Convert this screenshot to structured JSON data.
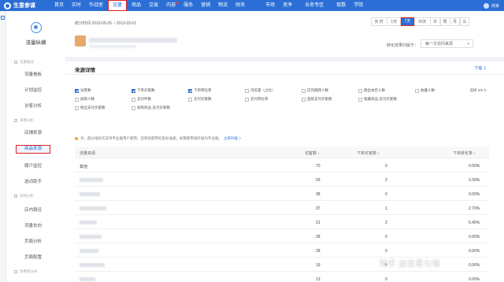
{
  "topnav": {
    "brand": "生意参谋",
    "items": [
      "首页",
      "实时",
      "作战室",
      "流量",
      "商品",
      "交易",
      "内容",
      "服务",
      "营销",
      "物流",
      "财务",
      "市场",
      "竞争",
      "业务专区",
      "取数",
      "学院"
    ],
    "active_item": "流量",
    "user": "商家"
  },
  "sidebar": {
    "title": "流量纵横",
    "groups": [
      {
        "label": "流量概况",
        "items": [
          "流量看板",
          "计划监控",
          "访客分析"
        ]
      },
      {
        "label": "来源分析",
        "items": [
          "店铺来源",
          "商品来源",
          "媒介监控",
          "选词助手"
        ]
      },
      {
        "label": "动线分析",
        "items": [
          "店内路径",
          "流量去向",
          "页面分析",
          "页面配置"
        ]
      },
      {
        "label": "消费者分析",
        "items": []
      }
    ],
    "active_item": "商品来源"
  },
  "statbar": {
    "time_label": "统计时间 2019-08-26 ~ 2019-09-01",
    "time_buttons": [
      "实 时",
      "1天",
      "7天",
      "30天",
      "日",
      "周",
      "月"
    ],
    "active_time": "7天",
    "conversion_label": "转化效果归属于：",
    "conversion_value": "每一次访问来源"
  },
  "panel": {
    "title": "来源详情",
    "download": "下载",
    "metrics": [
      {
        "label": "访客数",
        "checked": true
      },
      {
        "label": "下单买家数",
        "checked": true
      },
      {
        "label": "下单转化率",
        "checked": true
      },
      {
        "label": "浏览量（占比）",
        "checked": false
      },
      {
        "label": "店内跳转人数",
        "checked": false
      },
      {
        "label": "跳出本店人数",
        "checked": false
      },
      {
        "label": "收藏人数",
        "checked": false
      },
      {
        "label": "加购人数",
        "checked": false
      },
      {
        "label": "支付件数",
        "checked": false
      },
      {
        "label": "支付买家数",
        "checked": false
      },
      {
        "label": "支付转化率",
        "checked": false
      },
      {
        "label": "直接支付买家数",
        "checked": false
      },
      {
        "label": "收藏商品-支付买家数",
        "checked": false
      },
      {
        "label": "粉丝支付买家数",
        "checked": false
      },
      {
        "label": "加购商品-支付买家数",
        "checked": false
      }
    ],
    "selected_count": "选择 3/5",
    "notice_text": "亲，部分指标仅支持专业版用户使用，您目前使用的是标准版，如需使用请升级为专业版。",
    "notice_link": "立即升级 >"
  },
  "table": {
    "headers": [
      "流量来源",
      "访客数",
      "下单买家数",
      "下单转化率"
    ],
    "rows": [
      {
        "source": "其他",
        "visitors": "70",
        "buyers": "0",
        "rate": "0.00%"
      },
      {
        "source": "",
        "visitors": "59",
        "buyers": "2",
        "rate": "3.39%"
      },
      {
        "source": "",
        "visitors": "38",
        "buyers": "0",
        "rate": "0.00%"
      },
      {
        "source": "",
        "visitors": "37",
        "buyers": "1",
        "rate": "2.70%"
      },
      {
        "source": "",
        "visitors": "31",
        "buyers": "2",
        "rate": "6.45%"
      },
      {
        "source": "",
        "visitors": "28",
        "buyers": "0",
        "rate": "0.00%"
      },
      {
        "source": "",
        "visitors": "28",
        "buyers": "0",
        "rate": "0.00%"
      },
      {
        "source": "",
        "visitors": "19",
        "buyers": "0",
        "rate": "0.00%"
      },
      {
        "source": "",
        "visitors": "13",
        "buyers": "0",
        "rate": "0.00%"
      }
    ]
  },
  "watermark": "知乎 @吉星七喵",
  "colors": {
    "primary": "#2b6fd6",
    "highlight": "#e02020",
    "warning": "#f5a623"
  }
}
